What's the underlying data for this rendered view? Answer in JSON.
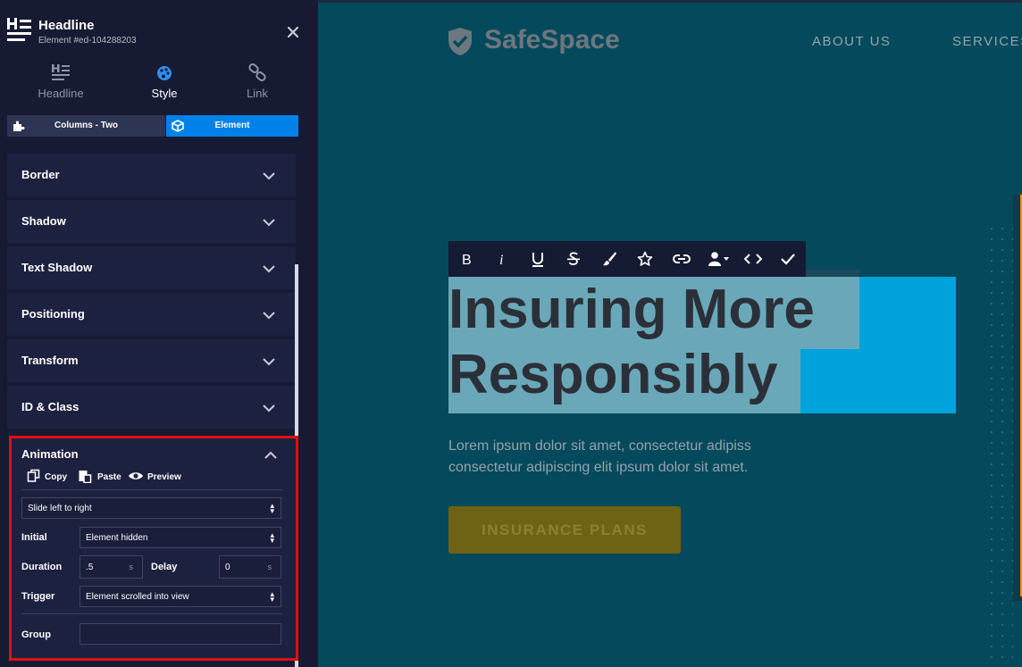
{
  "panel": {
    "title": "Headline",
    "element_id": "Element #ed-104288203",
    "tabs": [
      {
        "label": "Headline",
        "icon": "headline-icon"
      },
      {
        "label": "Style",
        "icon": "palette-icon"
      },
      {
        "label": "Link",
        "icon": "link-icon"
      }
    ],
    "active_tab": "Style",
    "breadcrumbs": [
      {
        "label": "Columns - Two",
        "icon": "puzzle-icon"
      },
      {
        "label": "Element",
        "icon": "cube-icon"
      }
    ],
    "sections": [
      "Border",
      "Shadow",
      "Text Shadow",
      "Positioning",
      "Transform",
      "ID & Class"
    ],
    "animation": {
      "title": "Animation",
      "tools": {
        "copy": "Copy",
        "paste": "Paste",
        "preview": "Preview"
      },
      "type_value": "Slide left to right",
      "initial_label": "Initial",
      "initial_value": "Element hidden",
      "duration_label": "Duration",
      "duration_value": ".5",
      "duration_unit": "s",
      "delay_label": "Delay",
      "delay_value": "0",
      "delay_unit": "s",
      "trigger_label": "Trigger",
      "trigger_value": "Element scrolled into view",
      "group_label": "Group",
      "group_value": ""
    }
  },
  "canvas": {
    "brand": "SafeSpace",
    "nav": [
      "ABOUT US",
      "SERVICES"
    ],
    "toolbar": [
      "bold-icon",
      "italic-icon",
      "underline-icon",
      "strikethrough-icon",
      "brush-icon",
      "star-icon",
      "link-icon",
      "person-icon",
      "code-icon",
      "check-icon"
    ],
    "headline_line1": "Insuring More",
    "headline_line2": "Responsibly",
    "body_text": "Lorem ipsum dolor sit amet, consectetur adipiss consectetur adipiscing elit ipsum dolor sit amet.",
    "cta": "INSURANCE PLANS"
  },
  "colors": {
    "sidebar_bg": "#161a33",
    "section_bg": "#1d2140",
    "accent_blue": "#0081e8",
    "highlight_red": "#e30d13",
    "canvas_bg": "#05495c",
    "headline_block": "#00a2dc",
    "cta_bg": "#6e6214"
  }
}
